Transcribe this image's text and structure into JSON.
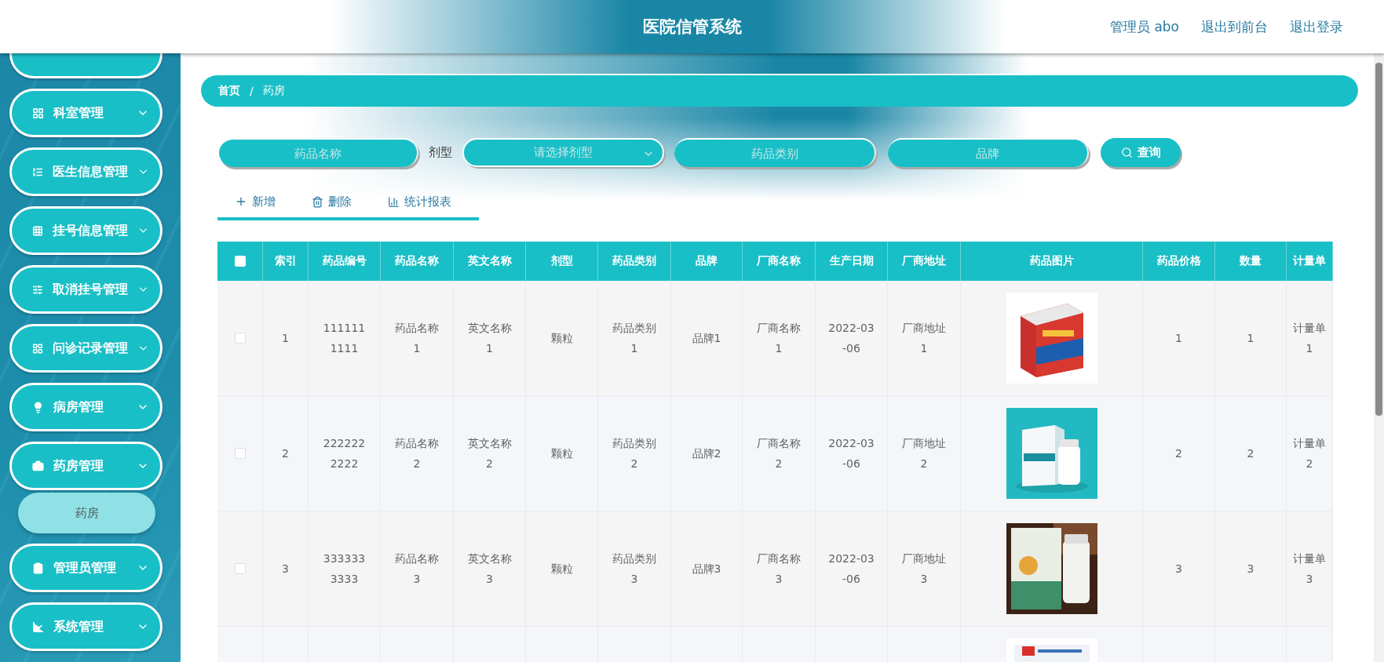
{
  "header": {
    "title": "医院信管系统",
    "links": [
      "管理员 abo",
      "退出到前台",
      "退出登录"
    ]
  },
  "sidebar": {
    "items": [
      {
        "label": "科室管理"
      },
      {
        "label": "医生信息管理"
      },
      {
        "label": "挂号信息管理"
      },
      {
        "label": "取消挂号管理"
      },
      {
        "label": "问诊记录管理"
      },
      {
        "label": "病房管理"
      },
      {
        "label": "药房管理",
        "expanded": true,
        "children": [
          {
            "label": "药房",
            "selected": true
          }
        ]
      },
      {
        "label": "管理员管理"
      },
      {
        "label": "系统管理"
      }
    ]
  },
  "breadcrumb": [
    "首页",
    "/",
    "药房"
  ],
  "search": {
    "name": {
      "placeholder": "药品名称"
    },
    "type_label": "剂型",
    "type": {
      "placeholder": "请选择剂型"
    },
    "category": {
      "placeholder": "药品类别"
    },
    "brand": {
      "placeholder": "品牌"
    },
    "button": "查询"
  },
  "actions": [
    {
      "kind": "add",
      "label": "新增"
    },
    {
      "kind": "delete",
      "label": "删除"
    },
    {
      "kind": "report",
      "label": "统计报表"
    }
  ],
  "table": {
    "select_all": {
      "checked": false
    },
    "columns": [
      {
        "label": "索引",
        "kind": "text"
      },
      {
        "label": "药品编号",
        "kind": "text"
      },
      {
        "label": "药品名称",
        "kind": "text"
      },
      {
        "label": "英文名称",
        "kind": "text"
      },
      {
        "label": "剂型",
        "kind": "text"
      },
      {
        "label": "药品类别",
        "kind": "text"
      },
      {
        "label": "品牌",
        "kind": "text"
      },
      {
        "label": "厂商名称",
        "kind": "text"
      },
      {
        "label": "生产日期",
        "kind": "text"
      },
      {
        "label": "厂商地址",
        "kind": "text"
      },
      {
        "label": "药品图片"
      },
      {
        "label": "药品价格",
        "kind": "text"
      },
      {
        "label": "数量",
        "kind": "text"
      },
      {
        "label": "计量单",
        "kind": "text"
      }
    ],
    "rows": [
      {
        "checked": false,
        "cells": [
          "1",
          "1111111111",
          "药品名称1",
          "英文名称1",
          "颗粒",
          "药品类别1",
          "品牌1",
          "厂商名称1",
          "2022-03-06",
          "厂商地址1",
          "1",
          "1",
          "计量单1"
        ],
        "image": {
          "kind": "picture"
        }
      },
      {
        "checked": false,
        "cells": [
          "2",
          "2222222222",
          "药品名称2",
          "英文名称2",
          "颗粒",
          "药品类别2",
          "品牌2",
          "厂商名称2",
          "2022-03-06",
          "厂商地址2",
          "2",
          "2",
          "计量单2"
        ],
        "image": {
          "kind": "picture"
        }
      },
      {
        "checked": false,
        "cells": [
          "3",
          "3333333333",
          "药品名称3",
          "英文名称3",
          "颗粒",
          "药品类别3",
          "品牌3",
          "厂商名称3",
          "2022-03-06",
          "厂商地址3",
          "3",
          "3",
          "计量单3"
        ],
        "image": {
          "kind": "picture"
        }
      },
      {
        "image": {
          "kind": "picture"
        }
      }
    ]
  }
}
